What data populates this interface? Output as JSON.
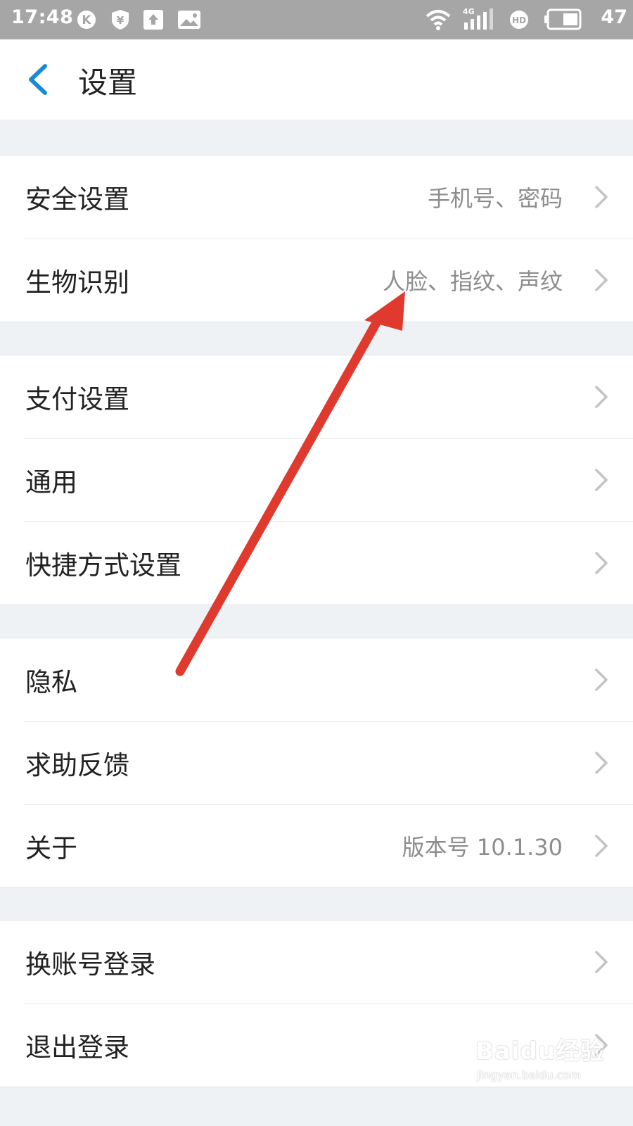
{
  "status_bar": {
    "time": "17:48",
    "network": "4G",
    "battery": "47",
    "icons": [
      "k-icon",
      "shield-yen-icon",
      "upload-icon",
      "image-icon",
      "wifi-icon",
      "signal-icon",
      "hd-icon",
      "battery-icon"
    ]
  },
  "header": {
    "title": "设置",
    "back_icon": "chevron-left-icon",
    "accent_color": "#1a88d8"
  },
  "sections": [
    [
      {
        "label": "安全设置",
        "value": "手机号、密码"
      },
      {
        "label": "生物识别",
        "value": "人脸、指纹、声纹"
      }
    ],
    [
      {
        "label": "支付设置",
        "value": ""
      },
      {
        "label": "通用",
        "value": ""
      },
      {
        "label": "快捷方式设置",
        "value": ""
      }
    ],
    [
      {
        "label": "隐私",
        "value": ""
      },
      {
        "label": "求助反馈",
        "value": ""
      },
      {
        "label": "关于",
        "value": "版本号 10.1.30"
      }
    ],
    [
      {
        "label": "换账号登录",
        "value": ""
      },
      {
        "label": "退出登录",
        "value": ""
      }
    ]
  ],
  "annotation": {
    "type": "arrow",
    "color": "#e03a2f",
    "points_to": "生物识别"
  },
  "watermark": {
    "text": "Baidu经验",
    "sub": "jingyan.baidu.com"
  }
}
